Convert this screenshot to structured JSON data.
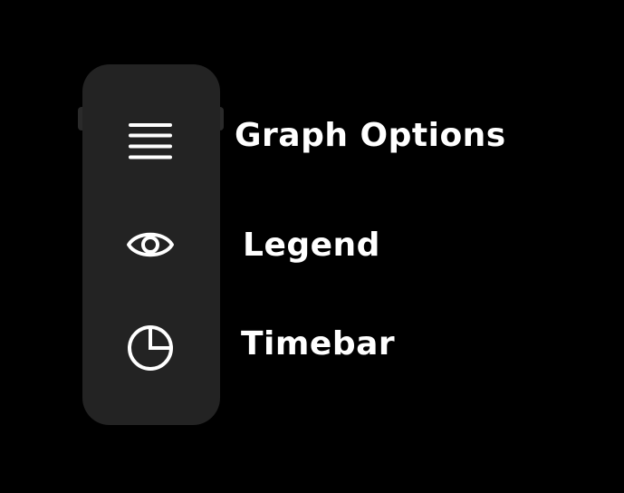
{
  "menu": {
    "items": [
      {
        "label": "Graph Options",
        "icon": "hamburger-menu-icon"
      },
      {
        "label": "Legend",
        "icon": "eye-icon"
      },
      {
        "label": "Timebar",
        "icon": "pie-chart-icon"
      }
    ]
  },
  "colors": {
    "background": "#000000",
    "sidebar": "#232323",
    "foreground": "#ffffff"
  }
}
